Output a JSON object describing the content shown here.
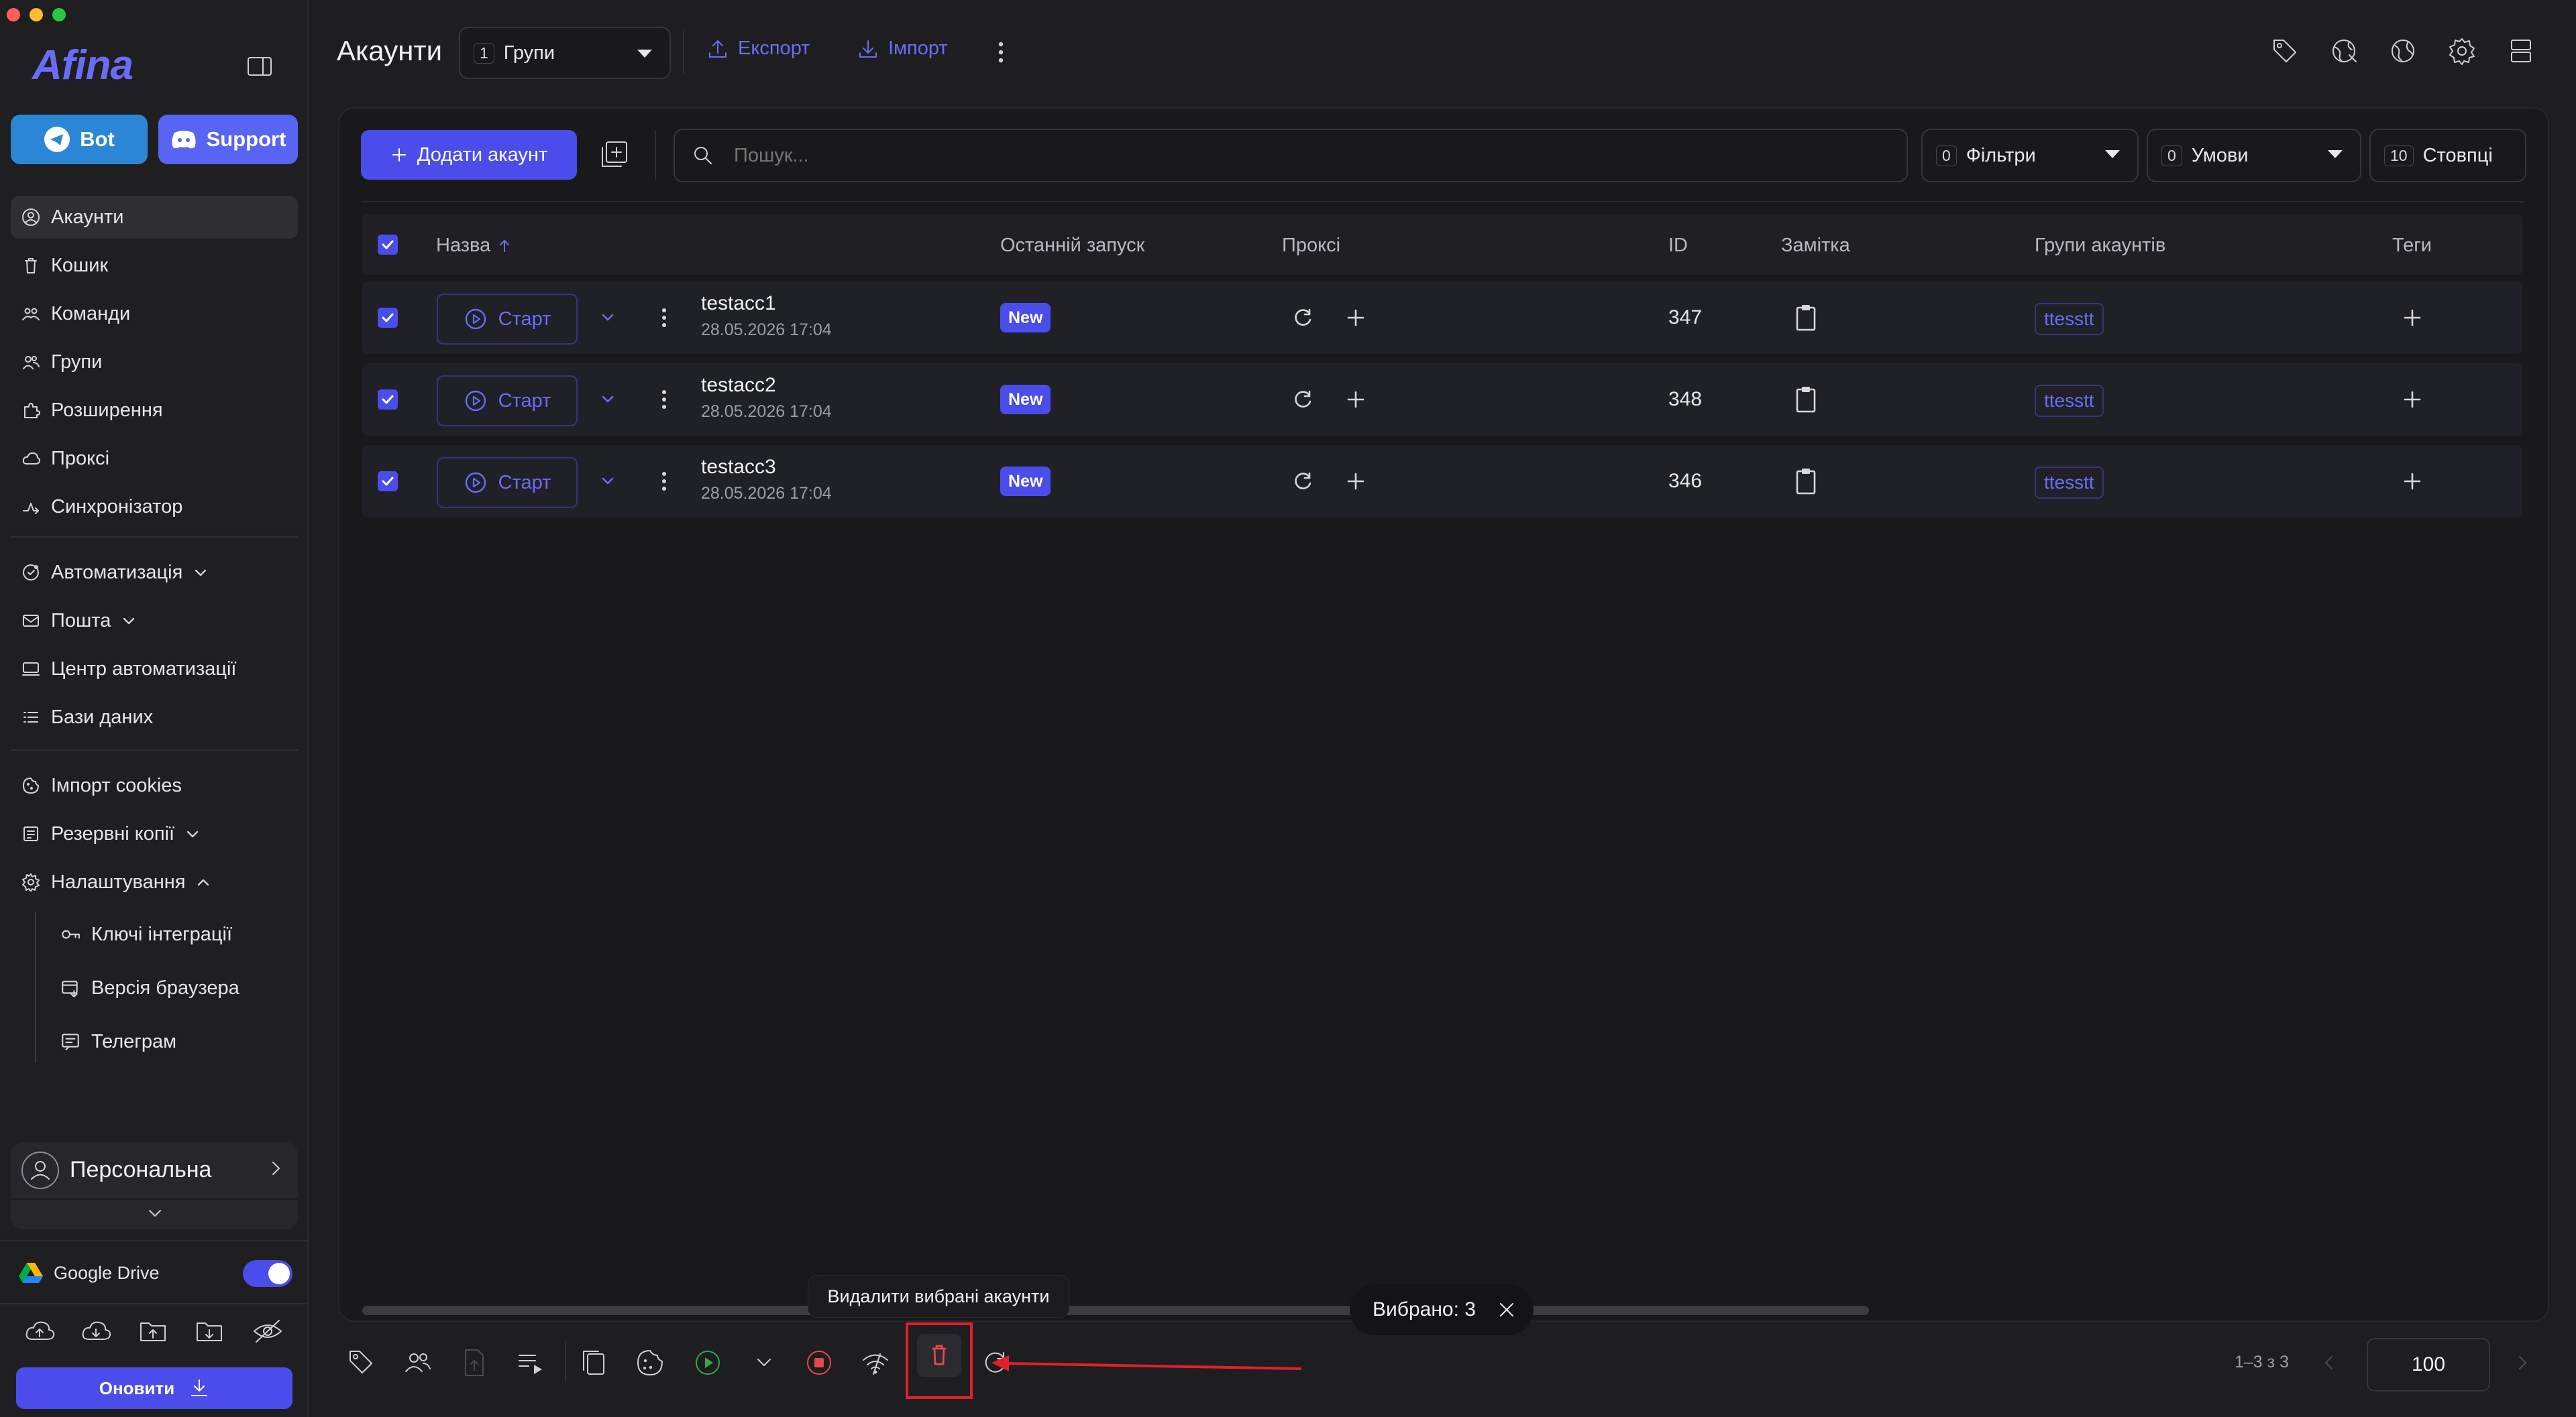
{
  "sidebar": {
    "logo": "Afina",
    "bot_label": "Bot",
    "support_label": "Support",
    "nav": [
      {
        "label": "Акаунти",
        "icon": "user-circle-icon"
      },
      {
        "label": "Кошик",
        "icon": "trash-icon"
      },
      {
        "label": "Команди",
        "icon": "team-icon"
      },
      {
        "label": "Групи",
        "icon": "group-icon"
      },
      {
        "label": "Розширення",
        "icon": "puzzle-icon"
      },
      {
        "label": "Проксі",
        "icon": "cloud-icon"
      },
      {
        "label": "Синхронізатор",
        "icon": "sync-icon"
      }
    ],
    "nav2": [
      {
        "label": "Автоматизація",
        "icon": "automation-icon"
      },
      {
        "label": "Пошта",
        "icon": "mail-icon"
      },
      {
        "label": "Центр автоматизації",
        "icon": "monitor-icon"
      },
      {
        "label": "Бази даних",
        "icon": "list-icon"
      }
    ],
    "nav3": [
      {
        "label": "Імпорт cookies",
        "icon": "cookie-icon"
      },
      {
        "label": "Резервні копії",
        "icon": "backup-icon"
      },
      {
        "label": "Налаштування",
        "icon": "gear-icon"
      }
    ],
    "settings_sub": [
      {
        "label": "Ключі інтеграції",
        "icon": "key-icon"
      },
      {
        "label": "Версія браузера",
        "icon": "browser-icon"
      },
      {
        "label": "Телеграм",
        "icon": "chat-icon"
      }
    ],
    "workspace": "Персональна",
    "google_drive": "Google Drive",
    "google_drive_enabled": true,
    "update_label": "Оновити"
  },
  "header": {
    "title": "Акаунти",
    "groups_count": "1",
    "groups_label": "Групи",
    "export_label": "Експорт",
    "import_label": "Імпорт"
  },
  "toolbar": {
    "add_account": "Додати акаунт",
    "search_placeholder": "Пошук...",
    "filters_count": "0",
    "filters_label": "Фільтри",
    "conditions_count": "0",
    "conditions_label": "Умови",
    "columns_count": "10",
    "columns_label": "Стовпці"
  },
  "table": {
    "columns": {
      "name": "Назва",
      "last_run": "Останній запуск",
      "proxy": "Проксі",
      "id": "ID",
      "note": "Замітка",
      "groups": "Групи акаунтів",
      "tags": "Теги"
    },
    "start_label": "Старт",
    "rows": [
      {
        "name": "testacc1",
        "date": "28.05.2026 17:04",
        "status": "New",
        "id": "347",
        "group": "ttesstt"
      },
      {
        "name": "testacc2",
        "date": "28.05.2026 17:04",
        "status": "New",
        "id": "348",
        "group": "ttesstt"
      },
      {
        "name": "testacc3",
        "date": "28.05.2026 17:04",
        "status": "New",
        "id": "346",
        "group": "ttesstt"
      }
    ]
  },
  "bottom": {
    "tooltip": "Видалити вибрані акаунти",
    "selected": "Вибрано: 3",
    "pagination": "1–3 з 3",
    "page_size": "100"
  },
  "colors": {
    "accent": "#4b4dea",
    "accent_text": "#6b6cf6",
    "highlight": "#e0202a",
    "success": "#2fa84f",
    "danger": "#e5484d"
  }
}
